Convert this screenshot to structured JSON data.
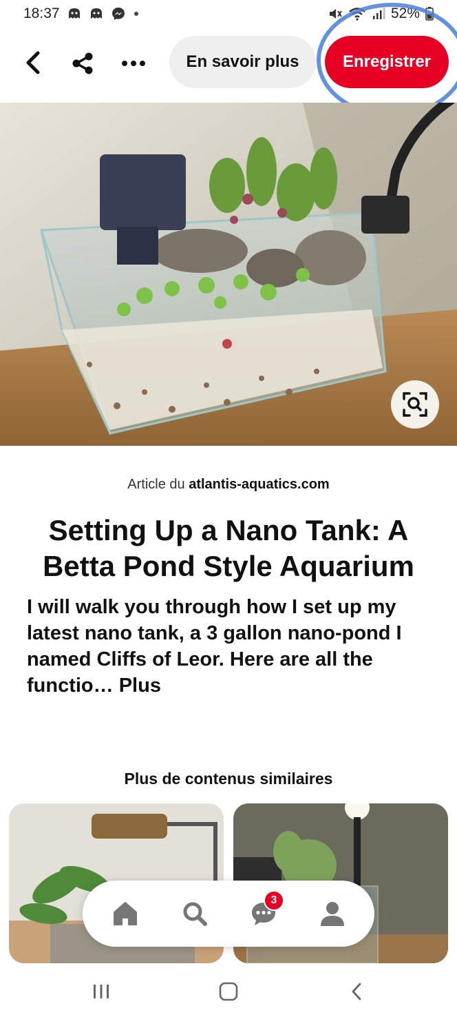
{
  "status_bar": {
    "time": "18:37",
    "battery": "52%",
    "left_icons": [
      "ghost-app-icon",
      "ghost-app-icon",
      "messenger-icon",
      "dot-icon"
    ],
    "right_icons": [
      "mute-icon",
      "wifi-icon",
      "signal-icon",
      "battery-icon"
    ]
  },
  "toolbar": {
    "learn_more_label": "En savoir plus",
    "save_label": "Enregistrer",
    "icons": [
      "back-arrow-icon",
      "share-icon",
      "more-options-icon"
    ]
  },
  "pin": {
    "source_prefix": "Article du",
    "source_domain": "atlantis-aquatics.com",
    "title": "Setting Up a Nano Tank: A Betta Pond Style Aquarium",
    "description": "I will walk you through how I set up my latest nano tank, a 3 gallon nano-pond I named Cliffs of Leor. Here are all the functio… Plus",
    "image_subject": "nano aquarium"
  },
  "related": {
    "heading": "Plus de contenus similaires",
    "cards": [
      "aquarium-plant-thumbnail",
      "nano-tank-thumbnail"
    ]
  },
  "bottom_nav": {
    "items": [
      "home-icon",
      "search-icon",
      "messages-icon",
      "profile-icon"
    ],
    "messages_badge": "3"
  },
  "system_nav": [
    "recent-apps-icon",
    "home-circle-icon",
    "back-chevron-icon"
  ],
  "colors": {
    "accent": "#e60023",
    "highlight_ring": "#4a7fd6",
    "secondary_button": "#efefef"
  }
}
